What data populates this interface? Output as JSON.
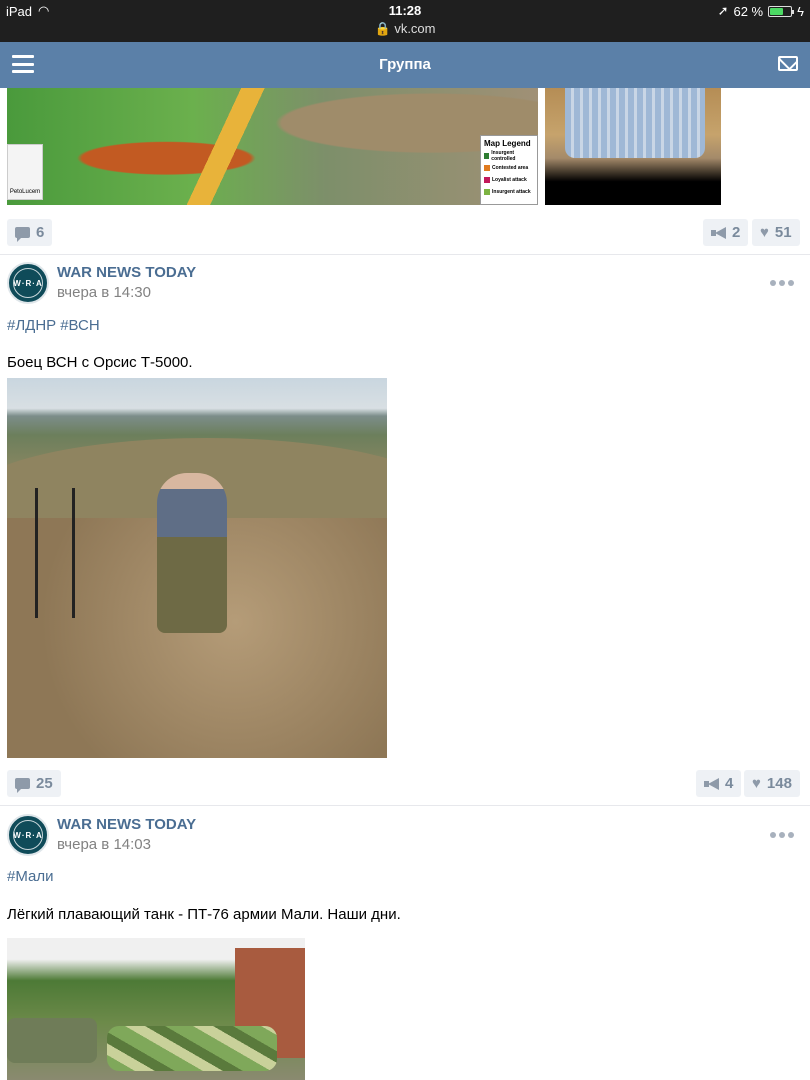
{
  "status_bar": {
    "device": "iPad",
    "time": "11:28",
    "url": "vk.com",
    "battery": "62 %",
    "battery_level": 0.62
  },
  "header": {
    "title": "Группа"
  },
  "top_post": {
    "map_legend_title": "Map Legend",
    "map_legend_rows": [
      "Insurgent controlled",
      "Contested area",
      "Loyalist attack",
      "Insurgent attack"
    ],
    "map_logo_text": "PetoLucem",
    "comments": "6",
    "reposts": "2",
    "likes": "51"
  },
  "posts": [
    {
      "author": "WAR NEWS TODAY",
      "time": "вчера в 14:30",
      "tags": [
        "#ЛДНР",
        "#ВСН"
      ],
      "text": "Боец ВСН с Орсис Т-5000.",
      "comments": "25",
      "reposts": "4",
      "likes": "148"
    },
    {
      "author": "WAR NEWS TODAY",
      "time": "вчера в 14:03",
      "tags": [
        "#Мали"
      ],
      "text": "Лёгкий плавающий танк - ПТ-76 армии Мали. Наши дни."
    }
  ],
  "icons": {
    "menu": "hamburger-icon",
    "mail": "mail-icon",
    "comment": "comment-icon",
    "share": "megaphone-icon",
    "like": "heart-icon",
    "more": "more-dots-icon"
  },
  "colors": {
    "header": "#5b80a8",
    "link": "#4a6d92",
    "pill_bg": "#eef1f5",
    "battery": "#4cd964"
  }
}
